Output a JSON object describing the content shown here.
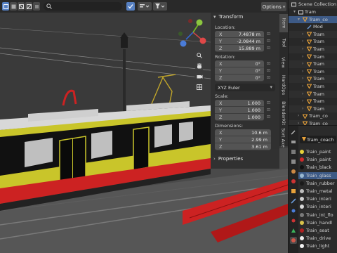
{
  "viewport": {
    "options_label": "Options",
    "nav_icons": [
      "zoom-icon",
      "hand-pan-icon",
      "camera-icon",
      "grid-icon"
    ],
    "gizmo_axes": [
      "X",
      "Y",
      "Z"
    ]
  },
  "npanel": {
    "transform_title": "Transform",
    "location_label": "Location:",
    "location": {
      "x": "7.4878 m",
      "y": "-2.0844 m",
      "z": "15.889 m"
    },
    "rotation_label": "Rotation:",
    "rotation": {
      "x": "0°",
      "y": "0°",
      "z": "0°"
    },
    "rotation_mode": "XYZ Euler",
    "scale_label": "Scale:",
    "scale": {
      "x": "1.000",
      "y": "1.000",
      "z": "1.000"
    },
    "dimensions_label": "Dimensions:",
    "dimensions": {
      "x": "10.6 m",
      "y": "2.99 m",
      "z": "3.61 m"
    },
    "properties_title": "Properties",
    "axis_letters": [
      "X",
      "Y",
      "Z"
    ]
  },
  "tabs": [
    "Item",
    "Tool",
    "View",
    "HardOps",
    "BlenderKit",
    "Sort Axe"
  ],
  "outliner": {
    "header": "Scene Collection",
    "rows": [
      {
        "label": "Tram",
        "indent": 1,
        "kind": "collection"
      },
      {
        "label": "Tram_co",
        "indent": 2,
        "kind": "object",
        "selected": true
      },
      {
        "label": "Mod",
        "indent": 3,
        "kind": "modifier"
      },
      {
        "label": "Tram",
        "indent": 3,
        "kind": "mesh"
      },
      {
        "label": "Tram",
        "indent": 3,
        "kind": "mesh"
      },
      {
        "label": "Tram",
        "indent": 3,
        "kind": "mesh"
      },
      {
        "label": "Tram",
        "indent": 3,
        "kind": "mesh"
      },
      {
        "label": "Tram",
        "indent": 3,
        "kind": "mesh"
      },
      {
        "label": "Tram",
        "indent": 3,
        "kind": "mesh"
      },
      {
        "label": "Tram",
        "indent": 3,
        "kind": "mesh"
      },
      {
        "label": "Tram",
        "indent": 3,
        "kind": "mesh"
      },
      {
        "label": "Tram",
        "indent": 3,
        "kind": "mesh"
      },
      {
        "label": "Tram",
        "indent": 3,
        "kind": "mesh"
      },
      {
        "label": "Tram",
        "indent": 3,
        "kind": "mesh"
      },
      {
        "label": "Tram_co",
        "indent": 2,
        "kind": "object"
      },
      {
        "label": "Tram_co",
        "indent": 2,
        "kind": "object"
      }
    ]
  },
  "properties": {
    "object_name": "Tram_coach",
    "materials": [
      {
        "label": "Train_paint",
        "color": "#e8d23a"
      },
      {
        "label": "Train_paint",
        "color": "#d02a2a"
      },
      {
        "label": "Train_black",
        "color": "#111111"
      },
      {
        "label": "Train_glass",
        "color": "#9ab8d0",
        "selected": true
      },
      {
        "label": "Train_rubber",
        "color": "#1a1a1a"
      },
      {
        "label": "Train_metal",
        "color": "#bdbdbd"
      },
      {
        "label": "Train_interi",
        "color": "#cfcfcf"
      },
      {
        "label": "Train_interi",
        "color": "#dadada"
      },
      {
        "label": "Train_int_flo",
        "color": "#7a7a7a"
      },
      {
        "label": "Train_handl",
        "color": "#d8c24a"
      },
      {
        "label": "Train_seat",
        "color": "#b02020"
      },
      {
        "label": "Train_drive",
        "color": "#eeeeee"
      },
      {
        "label": "Train_light",
        "color": "#f4f4f4"
      }
    ]
  },
  "colors": {
    "accent": "#5680c2",
    "selection": "#3d5a86",
    "tram_yellow": "#c9c52a",
    "tram_red": "#cc2222"
  }
}
